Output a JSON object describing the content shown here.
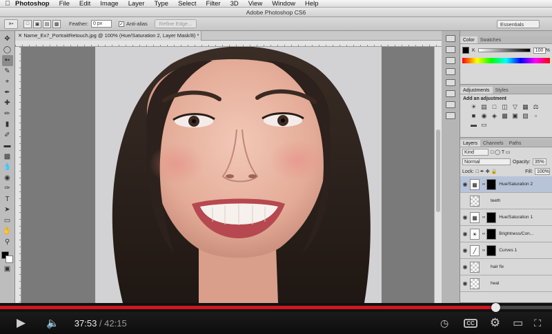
{
  "menubar": {
    "app": "Photoshop",
    "items": [
      "File",
      "Edit",
      "Image",
      "Layer",
      "Type",
      "Select",
      "Filter",
      "3D",
      "View",
      "Window",
      "Help"
    ]
  },
  "window": {
    "title": "Adobe Photoshop CS6"
  },
  "options": {
    "feather_label": "Feather:",
    "feather_value": "0 px",
    "antialias_label": "Anti-alias",
    "refine_label": "Refine Edge...",
    "workspace": "Essentials"
  },
  "document": {
    "tab_title": "Name_Ex7_PortraitRetouch.jpg @ 100% (Hue/Saturation 2, Layer Mask/8) *"
  },
  "color_panel": {
    "tabs": [
      "Color",
      "Swatches"
    ],
    "channel": "K",
    "value": "100",
    "unit": "%"
  },
  "adjustments_panel": {
    "tabs": [
      "Adjustments",
      "Styles"
    ],
    "title": "Add an adjustment"
  },
  "layers_panel": {
    "tabs": [
      "Layers",
      "Channels",
      "Paths"
    ],
    "kind": "Kind",
    "blend": "Normal",
    "opacity_label": "Opacity:",
    "opacity": "35%",
    "lock_label": "Lock:",
    "fill_label": "Fill:",
    "fill": "100%",
    "layers": [
      {
        "name": "Hue/Saturation 2",
        "type": "adjustment",
        "selected": true
      },
      {
        "name": "teeth",
        "type": "pixel",
        "selected": false
      },
      {
        "name": "Hue/Saturation 1",
        "type": "adjustment",
        "selected": false
      },
      {
        "name": "Brightness/Con...",
        "type": "adjustment",
        "selected": false
      },
      {
        "name": "Curves 1",
        "type": "adjustment",
        "selected": false
      },
      {
        "name": "hair fix",
        "type": "pixel",
        "selected": false
      },
      {
        "name": "heal",
        "type": "pixel",
        "selected": false
      }
    ]
  },
  "player": {
    "current_time": "37:53",
    "separator": " / ",
    "duration": "42:15",
    "progress": 0.897,
    "cc_label": "CC"
  },
  "colors": {
    "progress_red": "#cc181e",
    "accent_selected": "#b7c4d8"
  }
}
